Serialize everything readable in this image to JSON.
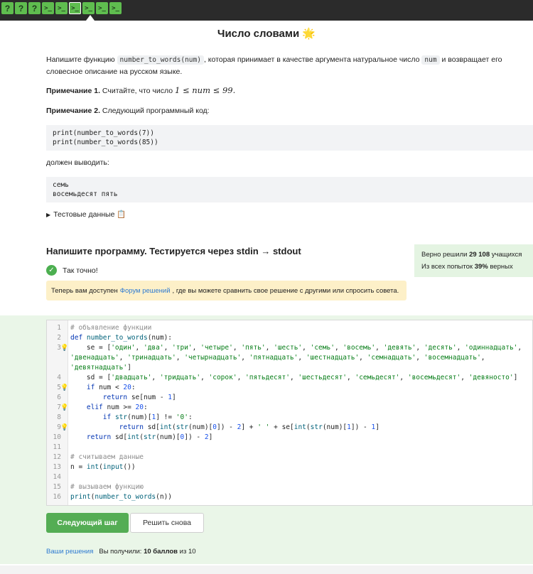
{
  "topbar": {
    "steps": [
      {
        "glyph": "?",
        "kind": "quiz"
      },
      {
        "glyph": "?",
        "kind": "quiz"
      },
      {
        "glyph": "?",
        "kind": "quiz"
      },
      {
        "glyph": ">_",
        "kind": "code"
      },
      {
        "glyph": ">_",
        "kind": "code"
      },
      {
        "glyph": ">_",
        "kind": "code",
        "active": true
      },
      {
        "glyph": ">_",
        "kind": "code"
      },
      {
        "glyph": ">_",
        "kind": "code"
      },
      {
        "glyph": ">_",
        "kind": "code"
      }
    ]
  },
  "task": {
    "title": "Число словами 🌟",
    "intro_a": "Напишите функцию ",
    "intro_code": "number_to_words(num)",
    "intro_b": ", которая принимает в качестве аргумента натуральное число ",
    "intro_code2": "num",
    "intro_c": " и возвращает его словесное описание на русском языке.",
    "note1_label": "Примечание 1.",
    "note1_text": " Считайте, что число ",
    "note1_math": "1 ≤ num ≤ 99.",
    "note2_label": "Примечание 2.",
    "note2_text": " Следующий программный код:",
    "code1_line1": "print(number_to_words(7))",
    "code1_line2": "print(number_to_words(85))",
    "should_output": "должен выводить:",
    "out_line1": "семь",
    "out_line2": "восемьдесят пять",
    "tests_label": "Тестовые данные 📋"
  },
  "submission": {
    "heading": "Напишите программу. Тестируется через stdin → stdout",
    "stats_a": "Верно решили ",
    "stats_count": "29 108",
    "stats_b": " учащихся",
    "stats_c": "Из всех попыток ",
    "stats_pct": "39%",
    "stats_d": " верных",
    "ok_text": "Так точно!",
    "notice_a": "Теперь вам доступен",
    "notice_link": "Форум решений",
    "notice_b": ", где вы можете сравнить свое решение с другими или спросить совета."
  },
  "editor": {
    "lines": [
      {
        "n": "1",
        "bulb": false,
        "code": "# объявление функции"
      },
      {
        "n": "2",
        "bulb": false,
        "code": "def number_to_words(num):"
      },
      {
        "n": "3",
        "bulb": true,
        "code": "    se = ['один', 'два', 'три', 'четыре', 'пять', 'шесть', 'семь', 'восемь', 'девять', 'десять', 'одиннадцать',"
      },
      {
        "n": "",
        "bulb": false,
        "code": "'двенадцать', 'тринадцать', 'четырнадцать', 'пятнадцать', 'шестнадцать', 'семнадцать', 'восемнадцать',"
      },
      {
        "n": "",
        "bulb": false,
        "code": "'девятнадцать']"
      },
      {
        "n": "4",
        "bulb": false,
        "code": "    sd = ['двадцать', 'тридцать', 'сорок', 'пятьдесят', 'шестьдесят', 'семьдесят', 'восемьдесят', 'девяносто']"
      },
      {
        "n": "5",
        "bulb": true,
        "code": "    if num < 20:"
      },
      {
        "n": "6",
        "bulb": false,
        "code": "        return se[num - 1]"
      },
      {
        "n": "7",
        "bulb": true,
        "code": "    elif num >= 20:"
      },
      {
        "n": "8",
        "bulb": false,
        "code": "        if str(num)[1] != '0':"
      },
      {
        "n": "9",
        "bulb": true,
        "code": "            return sd[int(str(num)[0]) - 2] + ' ' + se[int(str(num)[1]) - 1]"
      },
      {
        "n": "10",
        "bulb": false,
        "code": "    return sd[int(str(num)[0]) - 2]"
      },
      {
        "n": "11",
        "bulb": false,
        "code": ""
      },
      {
        "n": "12",
        "bulb": false,
        "code": "# считываем данные"
      },
      {
        "n": "13",
        "bulb": false,
        "code": "n = int(input())"
      },
      {
        "n": "14",
        "bulb": false,
        "code": ""
      },
      {
        "n": "15",
        "bulb": false,
        "code": "# вызываем функцию"
      },
      {
        "n": "16",
        "bulb": false,
        "code": "print(number_to_words(n))"
      }
    ]
  },
  "actions": {
    "next_label": "Следующий шаг",
    "retry_label": "Решить снова",
    "solutions_link": "Ваши решения",
    "score_a": "Вы получили: ",
    "score_value": "10 баллов",
    "score_b": " из 10"
  }
}
